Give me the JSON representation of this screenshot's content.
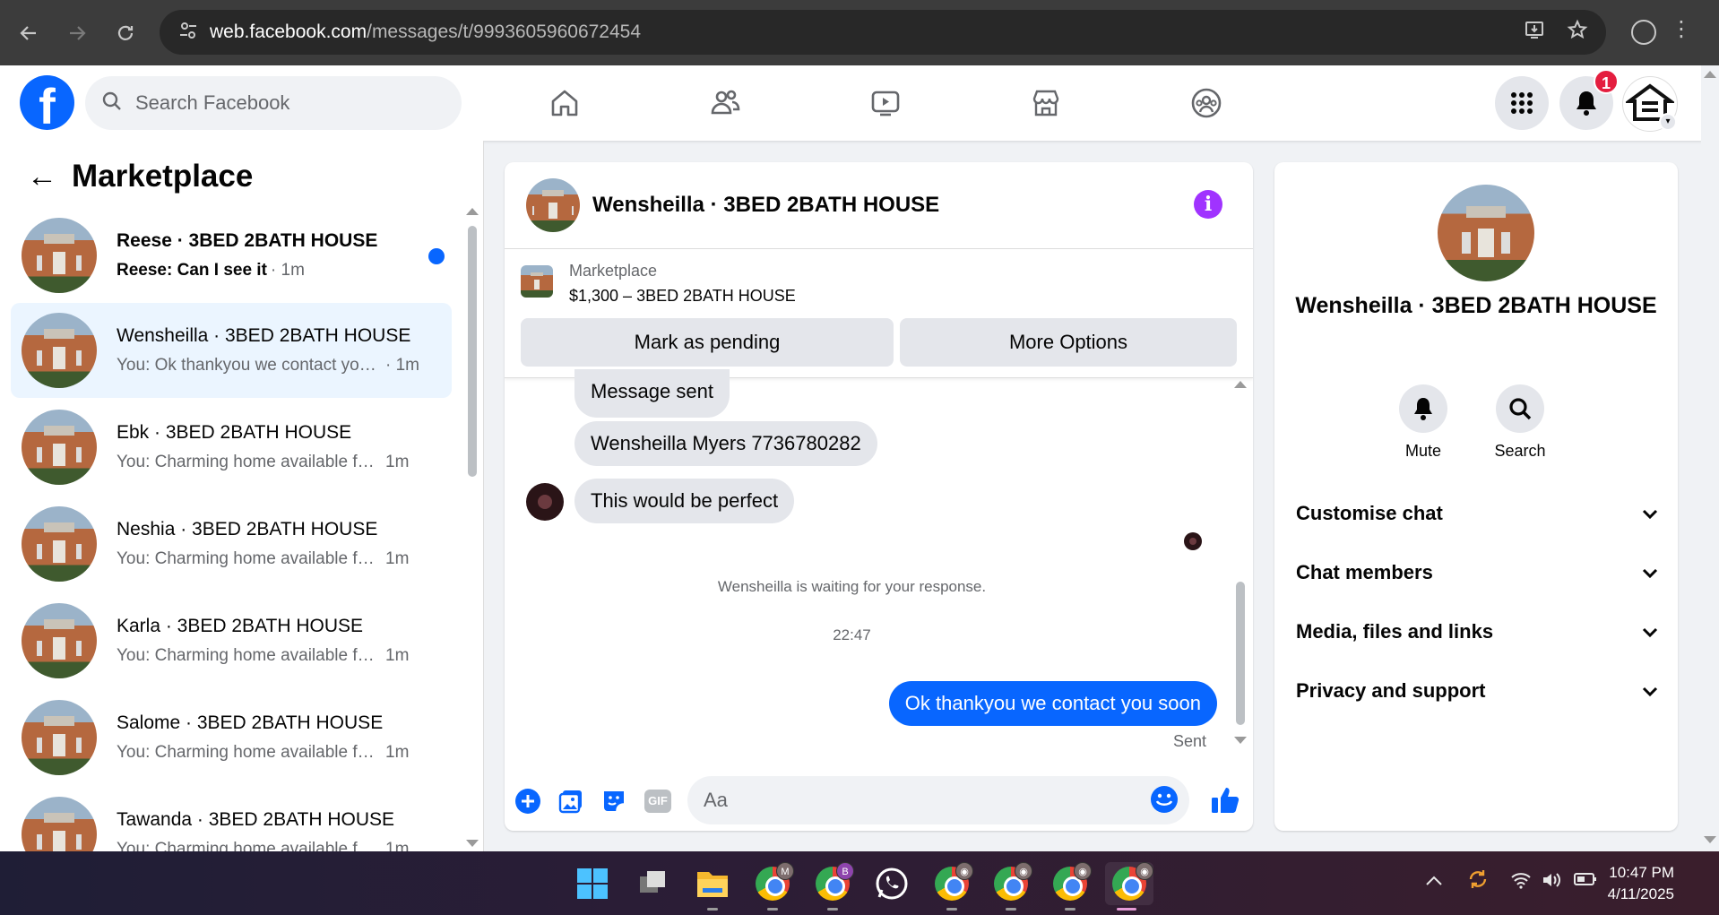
{
  "browser": {
    "url_host": "web.facebook.com",
    "url_path": "/messages/t/9993605960672454",
    "icons": [
      "back-arrow-icon",
      "forward-arrow-icon",
      "reload-icon",
      "site-settings-icon",
      "install-app-icon",
      "bookmark-star-icon",
      "profile-icon",
      "menu-kebab-icon"
    ]
  },
  "header": {
    "logo": "f",
    "search_placeholder": "Search Facebook",
    "nav_icons": [
      "home-icon",
      "friends-icon",
      "video-icon",
      "marketplace-icon",
      "groups-icon"
    ],
    "notification_count": "1"
  },
  "sidebar": {
    "back": "←",
    "title": "Marketplace",
    "conversations": [
      {
        "name": "Reese · 3BED 2BATH HOUSE",
        "snippet": "Reese: Can I see it",
        "time": "· 1m",
        "unread": true
      },
      {
        "name": "Wensheilla · 3BED 2BATH HOUSE",
        "snippet": "You: Ok thankyou we contact you ...",
        "time": "· 1m",
        "active": true
      },
      {
        "name": "Ebk · 3BED 2BATH HOUSE",
        "snippet": "You: Charming home available for ...",
        "time": "1m"
      },
      {
        "name": "Neshia · 3BED 2BATH HOUSE",
        "snippet": "You: Charming home available for ...",
        "time": "1m"
      },
      {
        "name": "Karla · 3BED 2BATH HOUSE",
        "snippet": "You: Charming home available for ...",
        "time": "1m"
      },
      {
        "name": "Salome · 3BED 2BATH HOUSE",
        "snippet": "You: Charming home available for ...",
        "time": "1m"
      },
      {
        "name": "Tawanda · 3BED 2BATH HOUSE",
        "snippet": "You: Charming home available for ...",
        "time": "1m"
      }
    ]
  },
  "chat": {
    "title": "Wensheilla · 3BED 2BATH HOUSE",
    "info": "i",
    "listing_label": "Marketplace",
    "listing_price": "$1,300 – 3BED 2BATH HOUSE",
    "mark_pending": "Mark as pending",
    "more_options": "More Options",
    "messages": [
      {
        "text": "Message sent",
        "from": "them"
      },
      {
        "text": "Wensheilla Myers 7736780282",
        "from": "them"
      },
      {
        "text": "This would be perfect",
        "from": "them"
      },
      {
        "text": "Ok thankyou we contact you soon",
        "from": "me"
      }
    ],
    "waiting": "Wensheilla is waiting for your response.",
    "timestamp": "22:47",
    "sent_status": "Sent",
    "composer_placeholder": "Aa",
    "composer_icons": [
      "plus-icon",
      "photo-icon",
      "sticker-icon",
      "gif-icon",
      "emoji-icon",
      "like-thumb-icon"
    ],
    "gif_label": "GIF"
  },
  "details": {
    "name": "Wensheilla · 3BED 2BATH HOUSE",
    "mute": "Mute",
    "search": "Search",
    "sections": [
      "Customise chat",
      "Chat members",
      "Media, files and links",
      "Privacy and support"
    ]
  },
  "taskbar": {
    "apps": [
      "start-icon",
      "task-view-icon",
      "file-explorer-icon",
      "chrome-icon",
      "chrome-icon",
      "whatsapp-icon",
      "chrome-icon",
      "chrome-icon",
      "chrome-icon",
      "chrome-icon"
    ],
    "profile_badges": [
      "M",
      "B"
    ],
    "time": "10:47 PM",
    "date": "4/11/2025"
  },
  "colors": {
    "brand_blue": "#0866ff",
    "info_purple": "#a033ff",
    "badge_red": "#e41e3f"
  }
}
